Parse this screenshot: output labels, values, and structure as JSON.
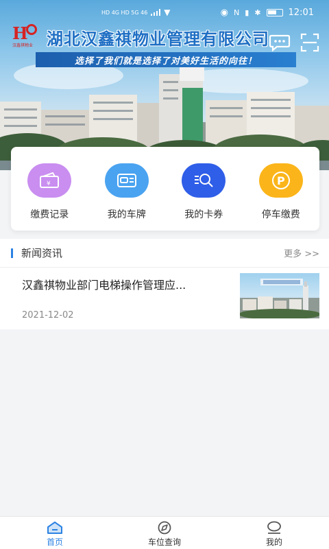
{
  "status_bar": {
    "left": "HD 4G HD 5G 46",
    "time": "12:01"
  },
  "banner": {
    "logo_text": "H",
    "logo_sub": "汉鑫祺物业",
    "company_name": "湖北汉鑫祺物业管理有限公司",
    "slogan": "选择了我们就是选择了对美好生活的向往！",
    "icons": [
      "chat-icon",
      "scan-icon"
    ]
  },
  "quick_actions": [
    {
      "label": "缴费记录",
      "icon": "payment-record-icon",
      "color": "#c98ef0"
    },
    {
      "label": "我的车牌",
      "icon": "license-plate-icon",
      "color": "#4aa3f0"
    },
    {
      "label": "我的卡券",
      "icon": "coupon-icon",
      "color": "#2f5ee8"
    },
    {
      "label": "停车缴费",
      "icon": "parking-icon",
      "color": "#fbb51a"
    }
  ],
  "news": {
    "section_title": "新闻资讯",
    "more": "更多 >>",
    "items": [
      {
        "title": "汉鑫祺物业部门电梯操作管理应...",
        "date": "2021-12-02"
      }
    ]
  },
  "bottom_nav": {
    "items": [
      {
        "label": "首页",
        "icon": "home-icon",
        "active": true
      },
      {
        "label": "车位查询",
        "icon": "compass-icon",
        "active": false
      },
      {
        "label": "我的",
        "icon": "profile-icon",
        "active": false
      }
    ]
  },
  "colors": {
    "accent": "#2b82e3",
    "company_blue": "#1f6fc4",
    "logo_red": "#d62323"
  }
}
